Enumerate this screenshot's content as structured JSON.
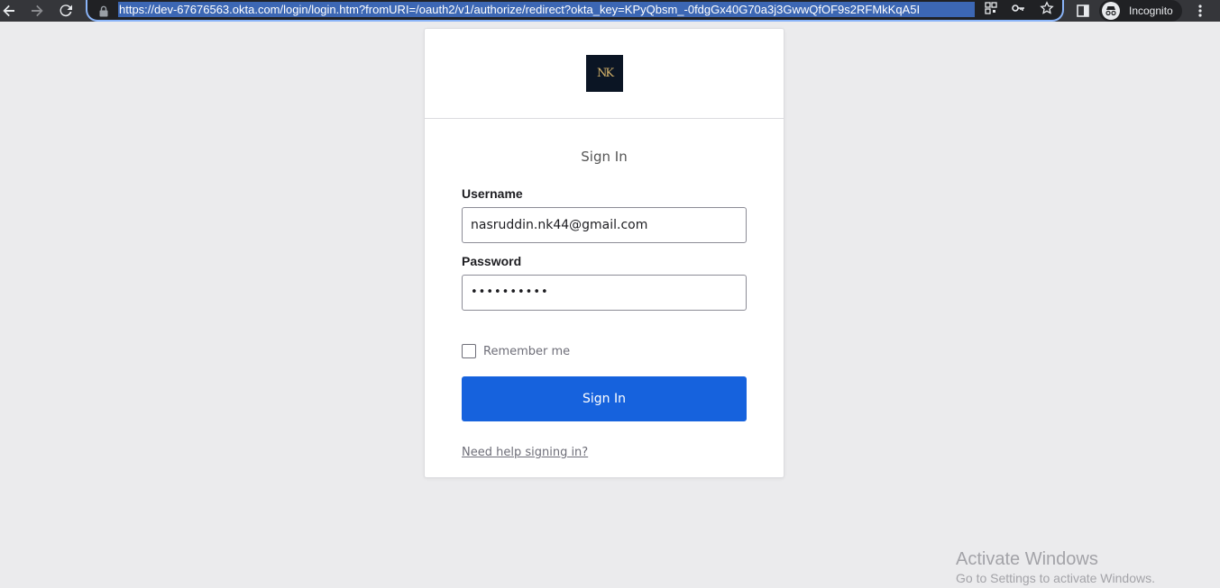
{
  "browser": {
    "url": "https://dev-67676563.okta.com/login/login.htm?fromURI=/oauth2/v1/authorize/redirect?okta_key=KPyQbsm_-0fdgGx40G70a3j3GwwQfOF9s2RFMkKqA5I",
    "incognito_label": "Incognito",
    "icons": [
      "back-icon",
      "forward-icon",
      "reload-icon",
      "lock-icon",
      "qr-code-icon",
      "key-icon",
      "star-icon",
      "side-panel-icon",
      "incognito-icon",
      "more-icon"
    ]
  },
  "brand": {
    "logo_text": "NK",
    "logo_bg": "#0b1524",
    "logo_fg": "#d7b46a"
  },
  "form": {
    "title": "Sign In",
    "username_label": "Username",
    "username_value": "nasruddin.nk44@gmail.com",
    "password_label": "Password",
    "password_value": "••••••••••",
    "remember_label": "Remember me",
    "remember_checked": false,
    "submit_label": "Sign In",
    "help_link": "Need help signing in?"
  },
  "colors": {
    "primary": "#1662dd",
    "page_bg": "#ebebed"
  },
  "watermark": {
    "title": "Activate Windows",
    "subtitle": "Go to Settings to activate Windows."
  }
}
